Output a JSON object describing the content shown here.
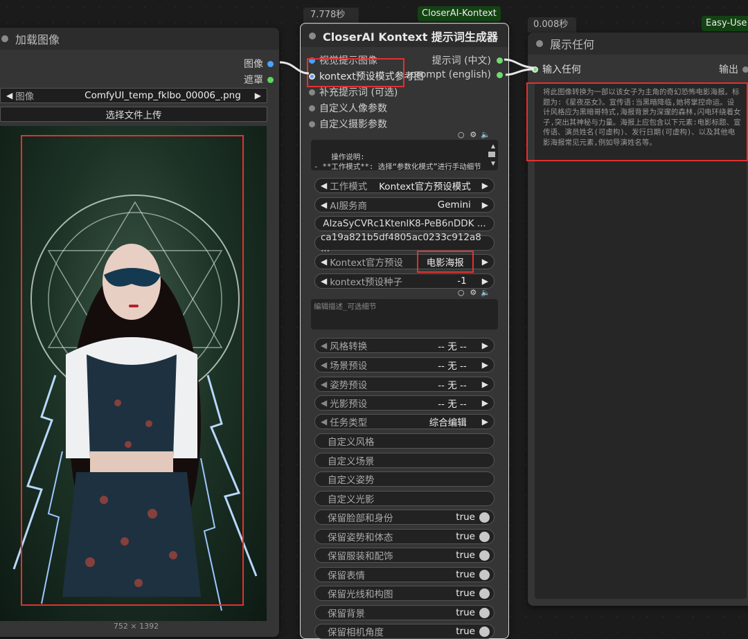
{
  "load_image_node": {
    "title": "加载图像",
    "outputs": [
      "图像",
      "遮罩"
    ],
    "image_widget_label": "图像",
    "image_widget_value": "ComfyUI_temp_fklbo_00006_.png",
    "upload_button": "选择文件上传",
    "image_size": "752 × 1392"
  },
  "kontext_node": {
    "time": "7.778秒",
    "tag": "CloserAI-Kontext",
    "title": "CloserAI Kontext 提示词生成器",
    "inputs": [
      "视觉提示图像",
      "kontext预设模式参考图",
      "补充提示词 (可选)",
      "自定义人像参数",
      "自定义摄影参数"
    ],
    "outputs": [
      "提示词 (中文)",
      "prompt (english)"
    ],
    "instructions": "操作说明:\n- **工作模式**: 选择“参数化模式”进行手动细节控制, 或选择“Kontext官方预设模",
    "edit_placeholder": "编辑描述_可选细节",
    "combo_widgets": [
      {
        "label": "工作模式",
        "value": "Kontext官方预设模式"
      },
      {
        "label": "AI服务商",
        "value": "Gemini"
      }
    ],
    "text_widgets": [
      "AIzaSyCVRc1KtenlK8-PeB6nDDK ...",
      "ca19a821b5df4805ac0233c912a8 ..."
    ],
    "preset_widgets": [
      {
        "label": "Kontext官方预设",
        "value": "电影海报"
      },
      {
        "label": "kontext预设种子",
        "value": "-1"
      }
    ],
    "preset_combos": [
      {
        "label": "风格转换",
        "value": "-- 无 --"
      },
      {
        "label": "场景预设",
        "value": "-- 无 --"
      },
      {
        "label": "姿势预设",
        "value": "-- 无 --"
      },
      {
        "label": "光影预设",
        "value": "-- 无 --"
      },
      {
        "label": "任务类型",
        "value": "综合编辑"
      }
    ],
    "custom_fields": [
      "自定义风格",
      "自定义场景",
      "自定义姿势",
      "自定义光影"
    ],
    "toggles": [
      {
        "label": "保留脸部和身份",
        "value": "true"
      },
      {
        "label": "保留姿势和体态",
        "value": "true"
      },
      {
        "label": "保留服装和配饰",
        "value": "true"
      },
      {
        "label": "保留表情",
        "value": "true"
      },
      {
        "label": "保留光线和构图",
        "value": "true"
      },
      {
        "label": "保留背景",
        "value": "true"
      },
      {
        "label": "保留相机角度",
        "value": "true"
      }
    ]
  },
  "show_node": {
    "time": "0.008秒",
    "tag": "Easy-Use",
    "title": "展示任何",
    "input": "输入任何",
    "output": "输出",
    "text": "将此图像转换为一部以该女子为主角的奇幻恐怖电影海报。标题为:《星夜巫女》。宣传语:当黑暗降临,她将掌控命运。设计风格应为黑暗哥特式,海报背景为深邃的森林,闪电环绕着女子,突出其神秘与力量。海报上应包含以下元素:电影标题、宣传语、演员姓名(可虚构)、发行日期(可虚构)、以及其他电影海报常见元素,例如导演姓名等。"
  },
  "colors": {
    "image_socket": "#4aa3ff",
    "mask_socket": "#5ed65e",
    "string_socket": "#6fdc6f",
    "highlight": "#e53030"
  }
}
